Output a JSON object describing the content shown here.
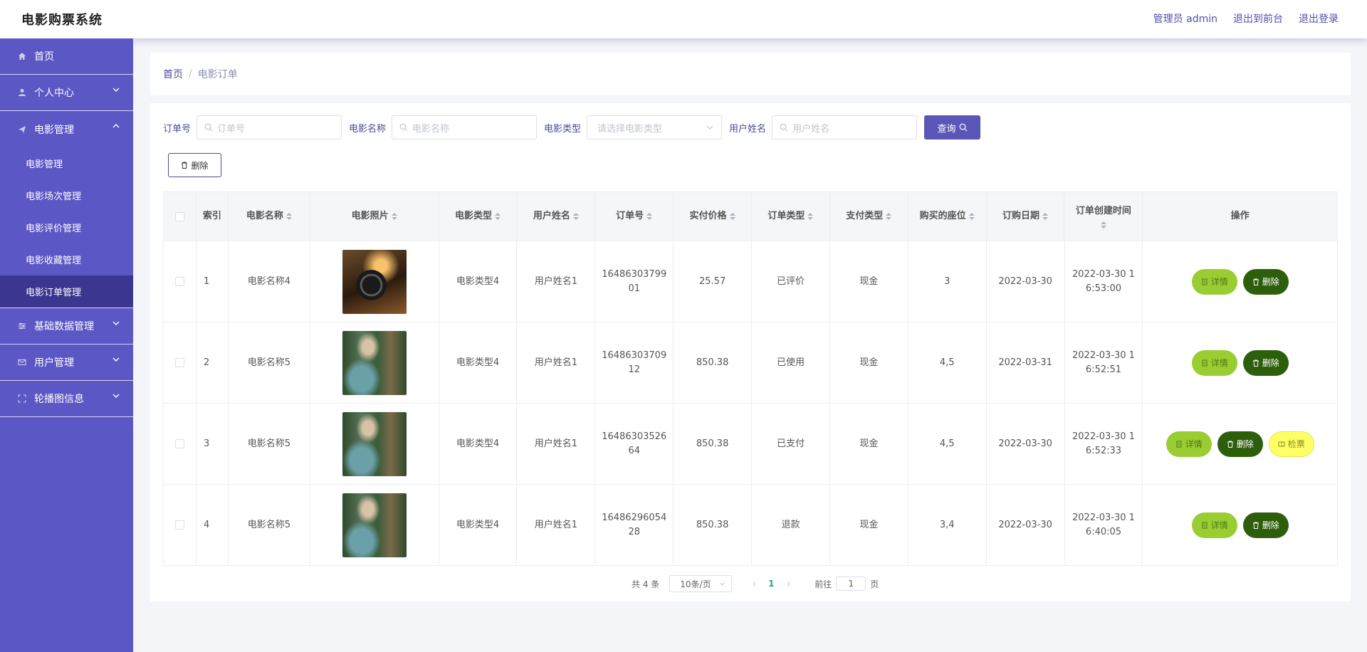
{
  "header": {
    "app_title": "电影购票系统",
    "admin_label": "管理员 admin",
    "front_link": "退出到前台",
    "logout_link": "退出登录"
  },
  "sidebar": {
    "items": [
      {
        "label": "首页",
        "icon": "home-icon"
      },
      {
        "label": "个人中心",
        "icon": "user-icon"
      },
      {
        "label": "电影管理",
        "icon": "paper-plane-icon"
      },
      {
        "label": "基础数据管理",
        "icon": "sliders-icon"
      },
      {
        "label": "用户管理",
        "icon": "envelope-icon"
      },
      {
        "label": "轮播图信息",
        "icon": "fullscreen-icon"
      }
    ],
    "movie_sub": [
      {
        "label": "电影管理"
      },
      {
        "label": "电影场次管理"
      },
      {
        "label": "电影评价管理"
      },
      {
        "label": "电影收藏管理"
      },
      {
        "label": "电影订单管理"
      }
    ]
  },
  "breadcrumb": {
    "home": "首页",
    "sep": "/",
    "current": "电影订单"
  },
  "search": {
    "order_no_label": "订单号",
    "order_no_placeholder": "订单号",
    "movie_name_label": "电影名称",
    "movie_name_placeholder": "电影名称",
    "movie_type_label": "电影类型",
    "movie_type_placeholder": "请选择电影类型",
    "user_name_label": "用户姓名",
    "user_name_placeholder": "用户姓名",
    "query_button": "查询"
  },
  "toolbar": {
    "delete_label": "删除"
  },
  "table": {
    "headers": {
      "index": "索引",
      "movie_name": "电影名称",
      "movie_photo": "电影照片",
      "movie_type": "电影类型",
      "user_name": "用户姓名",
      "order_no": "订单号",
      "price": "实付价格",
      "order_type": "订单类型",
      "pay_type": "支付类型",
      "seats": "购买的座位",
      "order_date": "订购日期",
      "created_at": "订单创建时间",
      "actions": "操作"
    },
    "rows": [
      {
        "index": "1",
        "movie_name": "电影名称4",
        "poster": "reel",
        "movie_type": "电影类型4",
        "user_name": "用户姓名1",
        "order_no": "1648630379901",
        "price": "25.57",
        "order_type": "已评价",
        "pay_type": "现金",
        "seats": "3",
        "order_date": "2022-03-30",
        "created_at": "2022-03-30 16:53:00"
      },
      {
        "index": "2",
        "movie_name": "电影名称5",
        "poster": "scene",
        "movie_type": "电影类型4",
        "user_name": "用户姓名1",
        "order_no": "1648630370912",
        "price": "850.38",
        "order_type": "已使用",
        "pay_type": "现金",
        "seats": "4,5",
        "order_date": "2022-03-31",
        "created_at": "2022-03-30 16:52:51"
      },
      {
        "index": "3",
        "movie_name": "电影名称5",
        "poster": "scene",
        "movie_type": "电影类型4",
        "user_name": "用户姓名1",
        "order_no": "1648630352664",
        "price": "850.38",
        "order_type": "已支付",
        "pay_type": "现金",
        "seats": "4,5",
        "order_date": "2022-03-30",
        "created_at": "2022-03-30 16:52:33"
      },
      {
        "index": "4",
        "movie_name": "电影名称5",
        "poster": "scene",
        "movie_type": "电影类型4",
        "user_name": "用户姓名1",
        "order_no": "1648629605428",
        "price": "850.38",
        "order_type": "退款",
        "pay_type": "现金",
        "seats": "3,4",
        "order_date": "2022-03-30",
        "created_at": "2022-03-30 16:40:05"
      }
    ],
    "actions": {
      "detail": "详情",
      "delete": "删除",
      "check_ticket": "检票"
    }
  },
  "pagination": {
    "total": "共 4 条",
    "page_size": "10条/页",
    "current_page": "1",
    "goto_label": "前往",
    "goto_value": "1",
    "page_unit": "页"
  },
  "colors": {
    "sidebar": "#5b57c5",
    "sidebar_active": "#3b368f",
    "primary": "#5b57b8",
    "detail_btn": "#9acd32",
    "delete_btn": "#2d5e0c",
    "check_btn": "#ffff66"
  }
}
